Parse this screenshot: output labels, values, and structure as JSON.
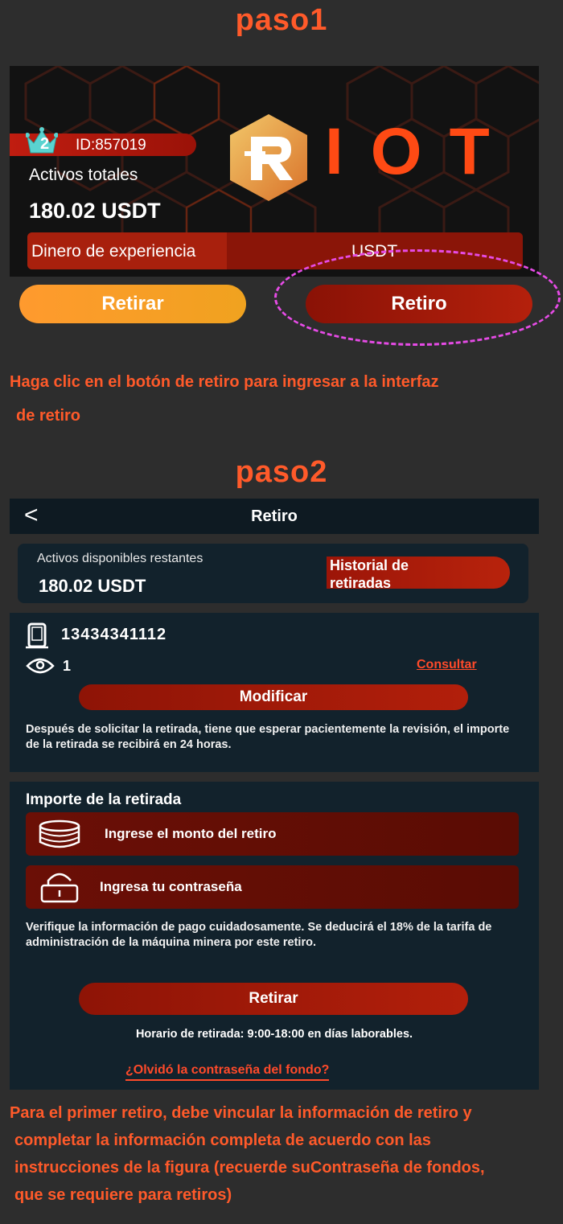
{
  "step1": {
    "title": "paso1",
    "banner": {
      "level": "2",
      "user_id": "ID:857019",
      "assets_label": "Activos totales",
      "assets_value": "180.02 USDT",
      "experience_label": "Dinero de experiencia",
      "currency_label": "USDT",
      "logo_text": "IOT"
    },
    "buttons": {
      "retirar": "Retirar",
      "retiro": "Retiro"
    },
    "instruction_line1": "Haga clic en el botón de retiro para ingresar a la interfaz",
    "instruction_line2": "de retiro"
  },
  "step2": {
    "title": "paso2",
    "topbar": {
      "back": "<",
      "title": "Retiro"
    },
    "assets_card": {
      "label": "Activos disponibles restantes",
      "value": "180.02 USDT",
      "history_line1": "Historial de",
      "history_line2": "retiradas"
    },
    "info_card": {
      "phone": "13434341112",
      "location_value": "1",
      "consult": "Consultar",
      "modify": "Modificar",
      "note": "Después de solicitar la retirada, tiene que esperar pacientemente la revisión, el importe de la retirada se recibirá en 24 horas."
    },
    "withdraw_card": {
      "title": "Importe de la retirada",
      "amount_placeholder": "Ingrese el monto del retiro",
      "password_placeholder": "Ingresa tu contraseña",
      "warning": "Verifique la información de pago cuidadosamente. Se deducirá el 18% de la tarifa de administración de la máquina minera por este retiro.",
      "submit": "Retirar",
      "schedule": "Horario de retirada: 9:00-18:00 en días laborables.",
      "forgot": "¿Olvidó la contraseña del fondo?"
    },
    "instruction_line1": "Para el primer retiro, debe vincular la información de retiro y",
    "instruction_line2": "completar la información completa de acuerdo con las",
    "instruction_line3": "instrucciones de la figura (recuerde suContraseña de fondos,",
    "instruction_line4": "que se requiere para retiros)"
  },
  "colors": {
    "accent": "#ff5a2a",
    "highlight": "#e64be6",
    "background": "#2d2d2d",
    "panel": "#12222c"
  }
}
